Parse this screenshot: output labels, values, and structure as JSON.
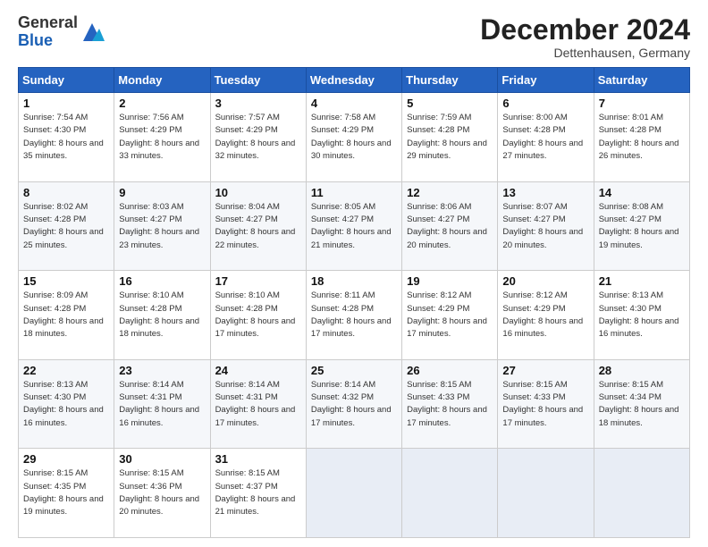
{
  "header": {
    "logo_general": "General",
    "logo_blue": "Blue",
    "month_title": "December 2024",
    "subtitle": "Dettenhausen, Germany"
  },
  "weekdays": [
    "Sunday",
    "Monday",
    "Tuesday",
    "Wednesday",
    "Thursday",
    "Friday",
    "Saturday"
  ],
  "weeks": [
    [
      {
        "day": "1",
        "sunrise": "7:54 AM",
        "sunset": "4:30 PM",
        "daylight": "8 hours and 35 minutes."
      },
      {
        "day": "2",
        "sunrise": "7:56 AM",
        "sunset": "4:29 PM",
        "daylight": "8 hours and 33 minutes."
      },
      {
        "day": "3",
        "sunrise": "7:57 AM",
        "sunset": "4:29 PM",
        "daylight": "8 hours and 32 minutes."
      },
      {
        "day": "4",
        "sunrise": "7:58 AM",
        "sunset": "4:29 PM",
        "daylight": "8 hours and 30 minutes."
      },
      {
        "day": "5",
        "sunrise": "7:59 AM",
        "sunset": "4:28 PM",
        "daylight": "8 hours and 29 minutes."
      },
      {
        "day": "6",
        "sunrise": "8:00 AM",
        "sunset": "4:28 PM",
        "daylight": "8 hours and 27 minutes."
      },
      {
        "day": "7",
        "sunrise": "8:01 AM",
        "sunset": "4:28 PM",
        "daylight": "8 hours and 26 minutes."
      }
    ],
    [
      {
        "day": "8",
        "sunrise": "8:02 AM",
        "sunset": "4:28 PM",
        "daylight": "8 hours and 25 minutes."
      },
      {
        "day": "9",
        "sunrise": "8:03 AM",
        "sunset": "4:27 PM",
        "daylight": "8 hours and 23 minutes."
      },
      {
        "day": "10",
        "sunrise": "8:04 AM",
        "sunset": "4:27 PM",
        "daylight": "8 hours and 22 minutes."
      },
      {
        "day": "11",
        "sunrise": "8:05 AM",
        "sunset": "4:27 PM",
        "daylight": "8 hours and 21 minutes."
      },
      {
        "day": "12",
        "sunrise": "8:06 AM",
        "sunset": "4:27 PM",
        "daylight": "8 hours and 20 minutes."
      },
      {
        "day": "13",
        "sunrise": "8:07 AM",
        "sunset": "4:27 PM",
        "daylight": "8 hours and 20 minutes."
      },
      {
        "day": "14",
        "sunrise": "8:08 AM",
        "sunset": "4:27 PM",
        "daylight": "8 hours and 19 minutes."
      }
    ],
    [
      {
        "day": "15",
        "sunrise": "8:09 AM",
        "sunset": "4:28 PM",
        "daylight": "8 hours and 18 minutes."
      },
      {
        "day": "16",
        "sunrise": "8:10 AM",
        "sunset": "4:28 PM",
        "daylight": "8 hours and 18 minutes."
      },
      {
        "day": "17",
        "sunrise": "8:10 AM",
        "sunset": "4:28 PM",
        "daylight": "8 hours and 17 minutes."
      },
      {
        "day": "18",
        "sunrise": "8:11 AM",
        "sunset": "4:28 PM",
        "daylight": "8 hours and 17 minutes."
      },
      {
        "day": "19",
        "sunrise": "8:12 AM",
        "sunset": "4:29 PM",
        "daylight": "8 hours and 17 minutes."
      },
      {
        "day": "20",
        "sunrise": "8:12 AM",
        "sunset": "4:29 PM",
        "daylight": "8 hours and 16 minutes."
      },
      {
        "day": "21",
        "sunrise": "8:13 AM",
        "sunset": "4:30 PM",
        "daylight": "8 hours and 16 minutes."
      }
    ],
    [
      {
        "day": "22",
        "sunrise": "8:13 AM",
        "sunset": "4:30 PM",
        "daylight": "8 hours and 16 minutes."
      },
      {
        "day": "23",
        "sunrise": "8:14 AM",
        "sunset": "4:31 PM",
        "daylight": "8 hours and 16 minutes."
      },
      {
        "day": "24",
        "sunrise": "8:14 AM",
        "sunset": "4:31 PM",
        "daylight": "8 hours and 17 minutes."
      },
      {
        "day": "25",
        "sunrise": "8:14 AM",
        "sunset": "4:32 PM",
        "daylight": "8 hours and 17 minutes."
      },
      {
        "day": "26",
        "sunrise": "8:15 AM",
        "sunset": "4:33 PM",
        "daylight": "8 hours and 17 minutes."
      },
      {
        "day": "27",
        "sunrise": "8:15 AM",
        "sunset": "4:33 PM",
        "daylight": "8 hours and 17 minutes."
      },
      {
        "day": "28",
        "sunrise": "8:15 AM",
        "sunset": "4:34 PM",
        "daylight": "8 hours and 18 minutes."
      }
    ],
    [
      {
        "day": "29",
        "sunrise": "8:15 AM",
        "sunset": "4:35 PM",
        "daylight": "8 hours and 19 minutes."
      },
      {
        "day": "30",
        "sunrise": "8:15 AM",
        "sunset": "4:36 PM",
        "daylight": "8 hours and 20 minutes."
      },
      {
        "day": "31",
        "sunrise": "8:15 AM",
        "sunset": "4:37 PM",
        "daylight": "8 hours and 21 minutes."
      },
      null,
      null,
      null,
      null
    ]
  ]
}
